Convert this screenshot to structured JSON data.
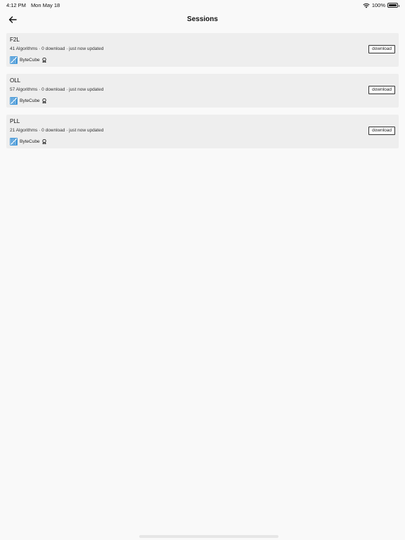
{
  "status_bar": {
    "time": "4:12 PM",
    "date": "Mon May 18",
    "battery_text": "100%",
    "battery_level": 1.0,
    "icons": [
      "wifi-icon",
      "battery-icon"
    ]
  },
  "nav": {
    "title": "Sessions",
    "back_icon": "arrow-left-icon"
  },
  "sessions": [
    {
      "title": "F2L",
      "meta": "41 Algorithms · 0 download · just now updated",
      "author": "ByteCube",
      "button_label": "download"
    },
    {
      "title": "OLL",
      "meta": "57 Algorithms · 0 download · just now updated",
      "author": "ByteCube",
      "button_label": "download"
    },
    {
      "title": "PLL",
      "meta": "21 Algorithms · 0 download · just now updated",
      "author": "ByteCube",
      "button_label": "download"
    }
  ],
  "colors": {
    "background": "#f9f9f9",
    "card": "#eeeeee",
    "avatar": "#4a9ad8"
  }
}
